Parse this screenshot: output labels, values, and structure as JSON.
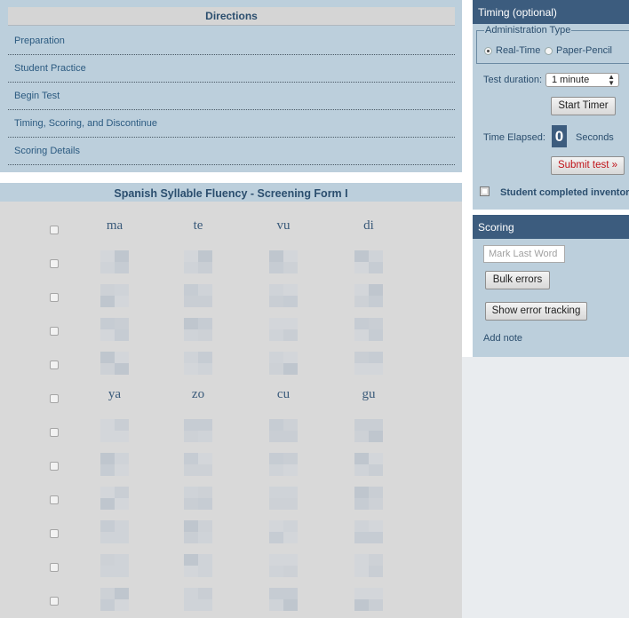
{
  "directions": {
    "title": "Directions",
    "items": [
      {
        "label": "Preparation"
      },
      {
        "label": "Student Practice"
      },
      {
        "label": "Begin Test"
      },
      {
        "label": "Timing, Scoring, and Discontinue"
      },
      {
        "label": "Scoring Details"
      }
    ]
  },
  "test": {
    "title": "Spanish Syllable Fluency - Screening Form I",
    "visible_syllables": {
      "row1": [
        "ma",
        "te",
        "vu",
        "di"
      ],
      "row6": [
        "ya",
        "zo",
        "cu",
        "gu"
      ]
    }
  },
  "timing": {
    "title": "Timing (optional)",
    "admin_type_legend": "Administration Type",
    "option_realtime": "Real-Time",
    "option_paper": "Paper-Pencil",
    "selected_option": "Real-Time",
    "duration_label": "Test duration:",
    "duration_value": "1 minute",
    "start_timer": "Start Timer",
    "elapsed_label": "Time Elapsed:",
    "elapsed_value": "0",
    "elapsed_unit": "Seconds",
    "submit": "Submit test »",
    "submit_color": "#c0141a",
    "completed_label": "Student completed inventory"
  },
  "scoring": {
    "title": "Scoring",
    "mark_last_word_placeholder": "Mark Last Word",
    "bulk_errors": "Bulk errors",
    "show_error_tracking": "Show error tracking",
    "add_note": "Add note"
  },
  "colors": {
    "panel_header": "#3c5c7e",
    "panel_bg": "#bccfdc",
    "test_bg": "#d9d9d9"
  }
}
